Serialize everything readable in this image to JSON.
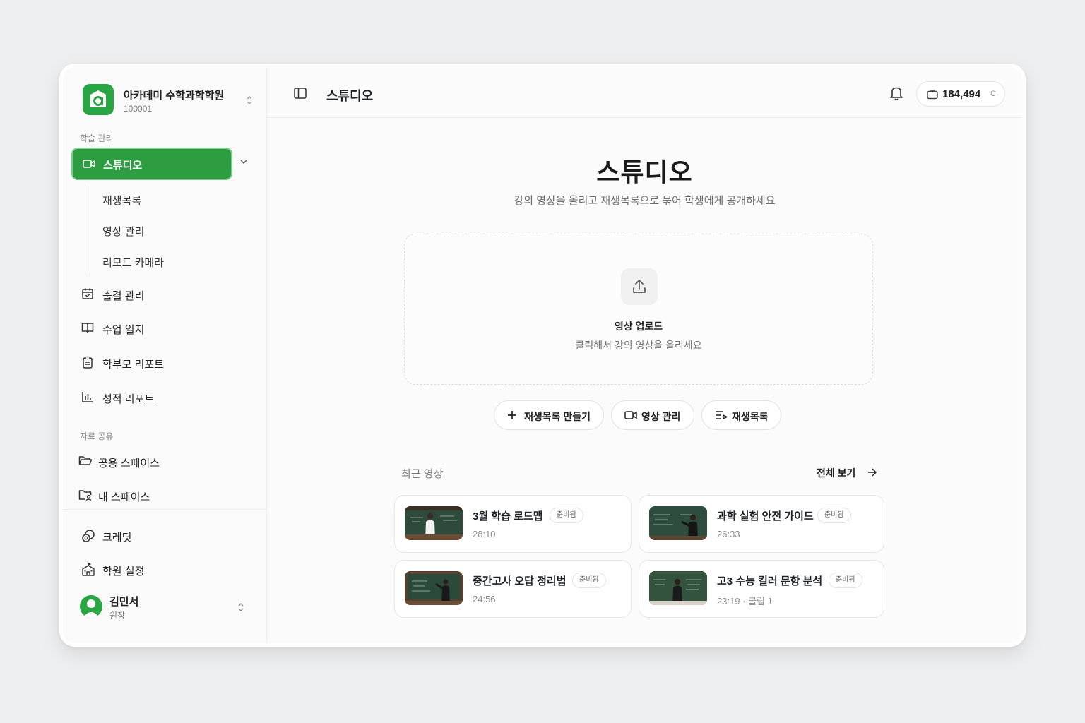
{
  "org": {
    "name": "아카데미 수학과학학원",
    "id": "100001"
  },
  "sidebar": {
    "section_learning": "학습 관리",
    "active_item": "스튜디오",
    "sub_items": [
      "재생목록",
      "영상 관리",
      "리모트 카메라"
    ],
    "items": [
      "출결 관리",
      "수업 일지",
      "학부모 리포트",
      "성적 리포트"
    ],
    "section_share": "자료 공유",
    "share_items": [
      "공용 스페이스",
      "내 스페이스"
    ],
    "bottom_items": [
      "크레딧",
      "학원 설정"
    ]
  },
  "user": {
    "name": "김민서",
    "role": "원장"
  },
  "topbar": {
    "title": "스튜디오",
    "credits": "184,494",
    "credit_unit": "C"
  },
  "hero": {
    "title": "스튜디오",
    "subtitle": "강의 영상을 올리고 재생목록으로 묶어 학생에게 공개하세요"
  },
  "upload": {
    "title": "영상 업로드",
    "subtitle": "클릭해서 강의 영상을 올리세요"
  },
  "actions": {
    "create_playlist": "재생목록 만들기",
    "manage_videos": "영상 관리",
    "playlists": "재생목록"
  },
  "recent": {
    "label": "최근 영상",
    "view_all": "전체 보기",
    "videos": [
      {
        "title": "3월 학습 로드맵",
        "badge": "준비됨",
        "meta": "28:10"
      },
      {
        "title": "과학 실험 안전 가이드",
        "badge": "준비됨",
        "meta": "26:33"
      },
      {
        "title": "중간고사 오답 정리법",
        "badge": "준비됨",
        "meta": "24:56"
      },
      {
        "title": "고3 수능 킬러 문항 분석",
        "badge": "준비됨",
        "meta": "23:19 · 클립 1"
      }
    ]
  },
  "colors": {
    "brand_green": "#2e9d42",
    "logo_green": "#2aa544"
  }
}
